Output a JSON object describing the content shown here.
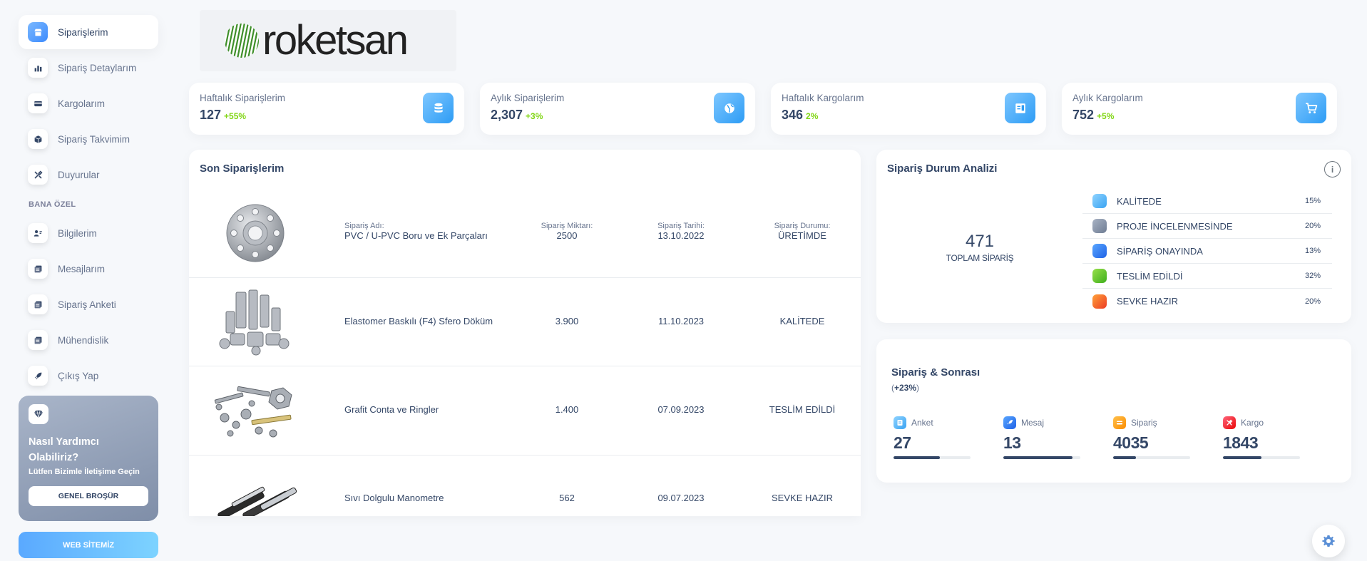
{
  "sidebar": {
    "items": [
      {
        "label": "Siparişlerim",
        "icon": "shop-icon"
      },
      {
        "label": "Sipariş Detaylarım",
        "icon": "chart-bar-icon"
      },
      {
        "label": "Kargolarım",
        "icon": "credit-card-icon"
      },
      {
        "label": "Sipariş Takvimim",
        "icon": "box-icon"
      },
      {
        "label": "Duyurular",
        "icon": "tools-icon"
      }
    ],
    "section_label": "BANA ÖZEL",
    "personal_items": [
      {
        "label": "Bilgilerim",
        "icon": "user-icon"
      },
      {
        "label": "Mesajlarım",
        "icon": "document-icon"
      },
      {
        "label": "Sipariş Anketi",
        "icon": "document-icon"
      },
      {
        "label": "Mühendislik",
        "icon": "document-icon"
      },
      {
        "label": "Çıkış Yap",
        "icon": "rocket-icon"
      }
    ],
    "help": {
      "title": "Nasıl Yardımcı Olabiliriz?",
      "subtitle": "Lütfen Bizimle İletişime Geçin",
      "button": "GENEL BROŞÜR"
    },
    "website_button": "WEB SİTEMİZ"
  },
  "logo": {
    "text": "roketsan"
  },
  "stats": [
    {
      "label": "Haftalık Siparişlerim",
      "value": "127",
      "change": "+55%",
      "icon": "database-icon"
    },
    {
      "label": "Aylık Siparişlerim",
      "value": "2,307",
      "change": "+3%",
      "icon": "globe-icon"
    },
    {
      "label": "Haftalık Kargolarım",
      "value": "346",
      "change": "2%",
      "icon": "document-icon"
    },
    {
      "label": "Aylık Kargolarım",
      "value": "752",
      "change": "+5%",
      "icon": "cart-icon"
    }
  ],
  "orders": {
    "title": "Son Siparişlerim",
    "labels": {
      "name": "Sipariş Adı:",
      "qty": "Sipariş Miktarı:",
      "date": "Sipariş Tarihi:",
      "status": "Sipariş Durumu:"
    },
    "rows": [
      {
        "name": "PVC / U-PVC Boru ve Ek Parçaları",
        "qty": "2500",
        "date": "13.10.2022",
        "status": "ÜRETİMDE",
        "image": "flange"
      },
      {
        "name": "Elastomer Baskılı (F4) Sfero Döküm",
        "qty": "3.900",
        "date": "11.10.2023",
        "status": "KALİTEDE",
        "image": "pipe-fittings"
      },
      {
        "name": "Grafit Conta ve Ringler",
        "qty": "1.400",
        "date": "07.09.2023",
        "status": "TESLİM EDİLDİ",
        "image": "bolts-nuts"
      },
      {
        "name": "Sıvı Dolgulu Manometre",
        "qty": "562",
        "date": "09.07.2023",
        "status": "SEVKE HAZIR",
        "image": "cylinders"
      }
    ]
  },
  "status_analysis": {
    "title": "Sipariş Durum Analizi",
    "info_icon": "i",
    "total": "471",
    "total_label": "TOPLAM SİPARİŞ",
    "items": [
      {
        "label": "KALİTEDE",
        "percent": "15%",
        "color": "#53b7f5"
      },
      {
        "label": "PROJE İNCELENMESİNDE",
        "percent": "20%",
        "color": "#8391a7"
      },
      {
        "label": "SİPARİŞ ONAYINDA",
        "percent": "13%",
        "color": "#2f7ff5"
      },
      {
        "label": "TESLİM EDİLDİ",
        "percent": "32%",
        "color": "#5cc62a"
      },
      {
        "label": "SEVKE HAZIR",
        "percent": "20%",
        "color": "#f3612a"
      }
    ]
  },
  "after_order": {
    "title": "Sipariş & Sonrası",
    "subtitle_prefix": "(",
    "subtitle_change": "+23%",
    "subtitle_suffix": ")",
    "metrics": [
      {
        "label": "Anket",
        "value": "27",
        "progress": 0.6,
        "color": "#5bb8ff",
        "icon": "document-icon"
      },
      {
        "label": "Mesaj",
        "value": "13",
        "progress": 0.9,
        "color": "#3d7ef5",
        "icon": "rocket-icon"
      },
      {
        "label": "Sipariş",
        "value": "4035",
        "progress": 0.3,
        "color": "#fb8c00",
        "icon": "credit-card-icon"
      },
      {
        "label": "Kargo",
        "value": "1843",
        "progress": 0.5,
        "color": "#ea2a3f",
        "icon": "tools-icon"
      }
    ]
  }
}
